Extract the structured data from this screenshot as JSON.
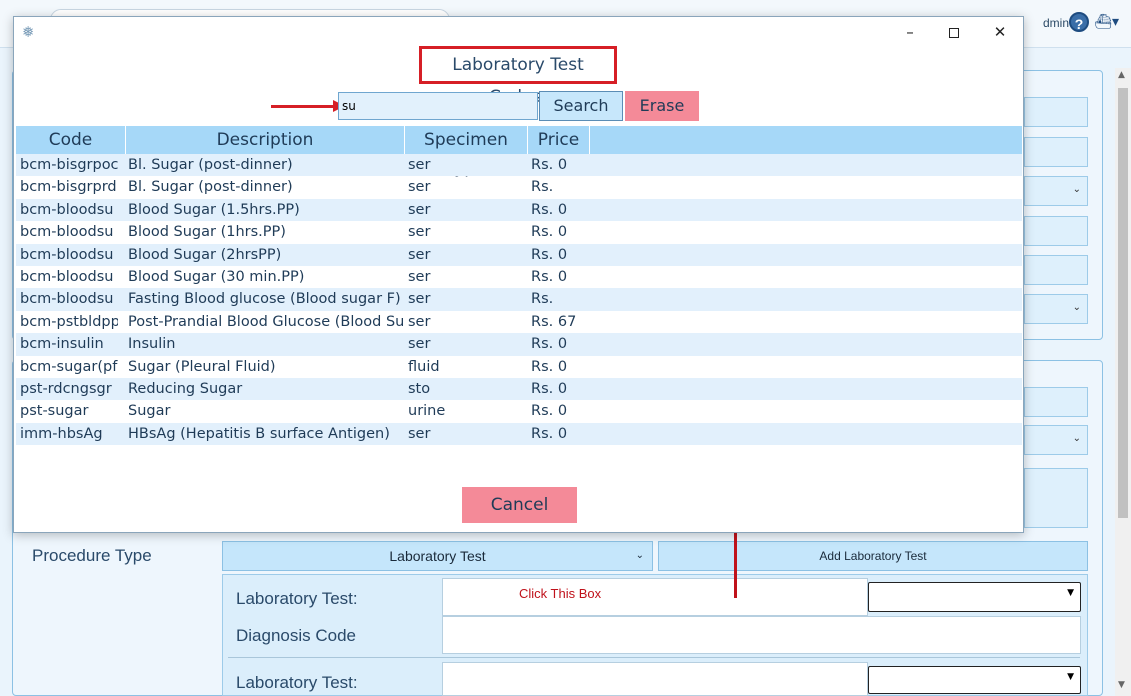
{
  "background": {
    "user_label": "dmin",
    "help_glyph": "?",
    "settings_glyph": "⛴▾",
    "procedure_label": "Procedure Type",
    "procedure_value": "Laboratory Test",
    "add_lab_button": "Add Laboratory Test",
    "lab_test_label": "Laboratory Test:",
    "diagnosis_label": "Diagnosis Code",
    "lab_test_label_2": "Laboratory Test:",
    "click_hint": "Click This Box"
  },
  "modal": {
    "heading": "Laboratory Test Codes:",
    "search_value": "su",
    "search_button": "Search",
    "erase_button": "Erase",
    "cancel_button": "Cancel",
    "window_controls": {
      "minimize": "–",
      "close": "✕"
    },
    "columns": [
      "Code",
      "Description",
      "Specimen Type",
      "Price"
    ],
    "rows": [
      {
        "code": "bcm-bisgrpoc",
        "description": "Bl. Sugar (post-dinner)",
        "specimen": "ser",
        "price": "Rs. 0"
      },
      {
        "code": "bcm-bisgrprd",
        "description": "Bl. Sugar (post-dinner)",
        "specimen": "ser",
        "price": "Rs."
      },
      {
        "code": "bcm-bloodsu",
        "description": "Blood Sugar (1.5hrs.PP)",
        "specimen": "ser",
        "price": "Rs. 0"
      },
      {
        "code": "bcm-bloodsu",
        "description": "Blood Sugar (1hrs.PP)",
        "specimen": "ser",
        "price": "Rs. 0"
      },
      {
        "code": "bcm-bloodsu",
        "description": "Blood Sugar (2hrsPP)",
        "specimen": "ser",
        "price": "Rs. 0"
      },
      {
        "code": "bcm-bloodsu",
        "description": "Blood Sugar (30 min.PP)",
        "specimen": "ser",
        "price": "Rs. 0"
      },
      {
        "code": "bcm-bloodsu",
        "description": "Fasting Blood glucose (Blood sugar F)",
        "specimen": "ser",
        "price": "Rs."
      },
      {
        "code": "bcm-pstbldpp",
        "description": "Post-Prandial Blood Glucose (Blood Su",
        "specimen": "ser",
        "price": "Rs. 67"
      },
      {
        "code": "bcm-insulin",
        "description": "Insulin",
        "specimen": "ser",
        "price": "Rs. 0"
      },
      {
        "code": "bcm-sugar(pf",
        "description": "Sugar (Pleural Fluid)",
        "specimen": "fluid",
        "price": "Rs. 0"
      },
      {
        "code": "pst-rdcngsgr",
        "description": "Reducing Sugar",
        "specimen": "sto",
        "price": "Rs. 0"
      },
      {
        "code": "pst-sugar",
        "description": "Sugar",
        "specimen": "urine",
        "price": "Rs. 0"
      },
      {
        "code": "imm-hbsAg",
        "description": "HBsAg (Hepatitis B surface Antigen)",
        "specimen": "ser",
        "price": "Rs. 0"
      }
    ]
  },
  "colors": {
    "accent_red": "#d61f26",
    "header_blue": "#a6d8f8",
    "row_alt": "#e2f0fc",
    "button_pink": "#f48a98"
  }
}
